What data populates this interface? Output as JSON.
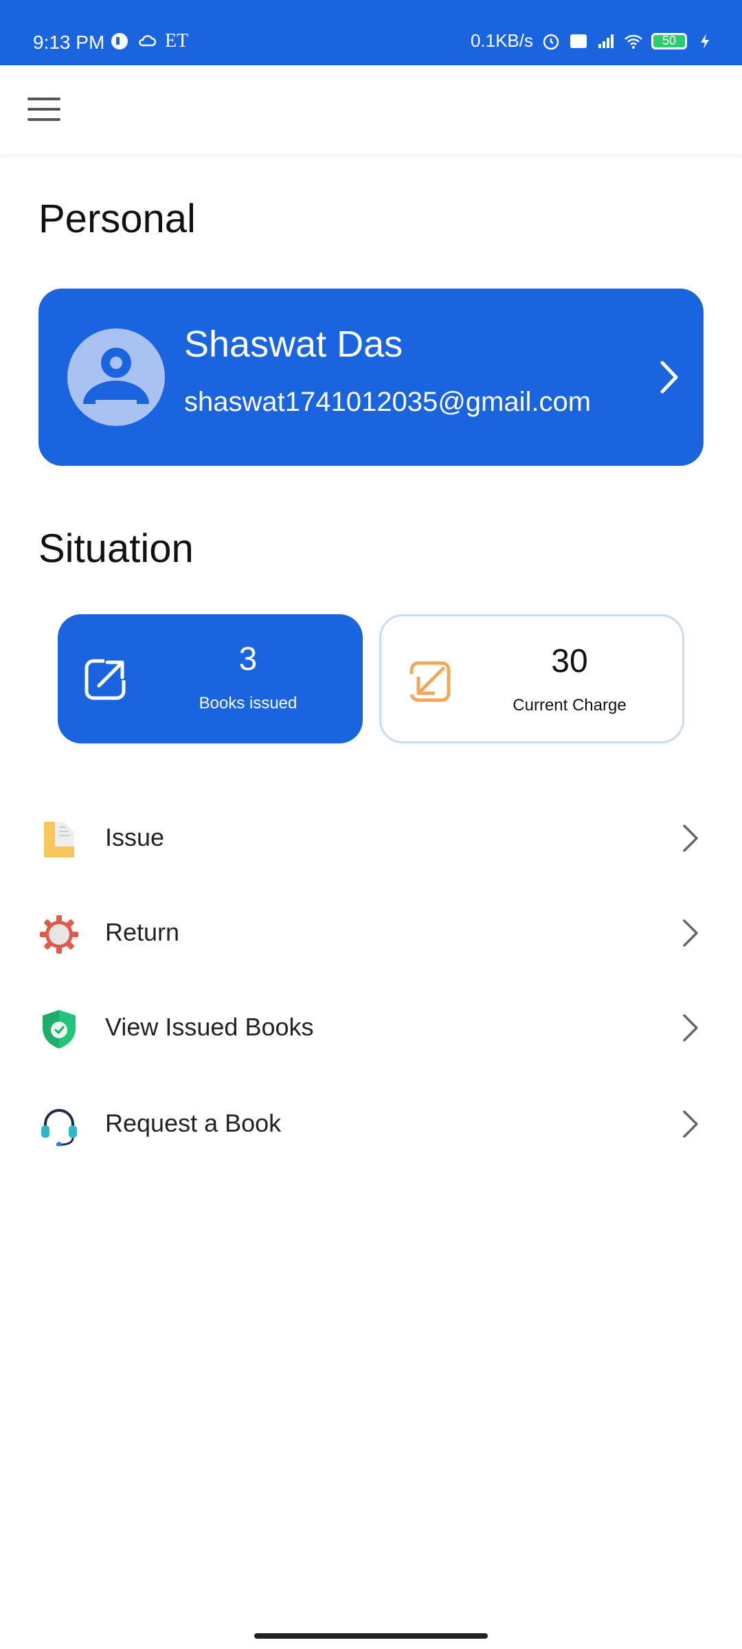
{
  "status_bar": {
    "time": "9:13 PM",
    "left_badge": "ET",
    "net_speed": "0.1KB/s",
    "battery": "50",
    "icons": [
      "chat-icon",
      "cloud-icon",
      "alarm-icon",
      "volte-icon",
      "signal-icon",
      "wifi-icon",
      "battery-icon",
      "charging-icon"
    ]
  },
  "appbar": {
    "menu_icon": "hamburger-icon"
  },
  "personal": {
    "title": "Personal",
    "name": "Shaswat Das",
    "email": "shaswat1741012035@gmail.com"
  },
  "situation": {
    "title": "Situation",
    "books_issued": {
      "value": "3",
      "label": "Books issued"
    },
    "current_charge": {
      "value": "30",
      "label": "Current Charge"
    }
  },
  "menu": [
    {
      "label": "Issue",
      "icon": "document-icon"
    },
    {
      "label": "Return",
      "icon": "gear-icon"
    },
    {
      "label": "View Issued Books",
      "icon": "shield-icon"
    },
    {
      "label": "Request a Book",
      "icon": "headset-icon"
    }
  ],
  "colors": {
    "primary": "#1a64df",
    "orange": "#f0a95a",
    "yellow": "#f6c65b",
    "red": "#e05a4a",
    "green": "#22b573",
    "teal": "#2bb8c8"
  }
}
